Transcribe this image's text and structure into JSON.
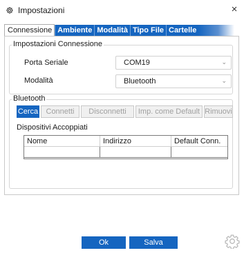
{
  "window": {
    "title": "Impostazioni",
    "close_glyph": "×"
  },
  "tabs": [
    {
      "label": "Connessione",
      "active": true
    },
    {
      "label": "Ambiente",
      "active": false
    },
    {
      "label": "Modalità",
      "active": false
    },
    {
      "label": "Tipo File",
      "active": false
    },
    {
      "label": "Cartelle",
      "active": false
    }
  ],
  "connection": {
    "group_title": "Impostazioni Connessione",
    "serial_port": {
      "label": "Porta Seriale",
      "value": "COM19"
    },
    "mode": {
      "label": "Modalità",
      "value": "Bluetooth"
    }
  },
  "bluetooth": {
    "group_title": "Bluetooth",
    "buttons": {
      "search": "Cerca",
      "connect": "Connetti",
      "disconnect": "Disconnetti",
      "set_default": "Imp. come Default",
      "remove": "Rimuovi"
    },
    "paired_title": "Dispositivi Accoppiati",
    "columns": [
      "Nome",
      "Indirizzo",
      "Default Conn."
    ]
  },
  "footer": {
    "ok": "Ok",
    "save": "Salva"
  },
  "icons": {
    "title": "gear-icon",
    "dropdown": "chevron-down-icon",
    "settings": "gear-icon"
  },
  "colors": {
    "accent": "#1565c0",
    "disabled_text": "#a0a0a0"
  }
}
